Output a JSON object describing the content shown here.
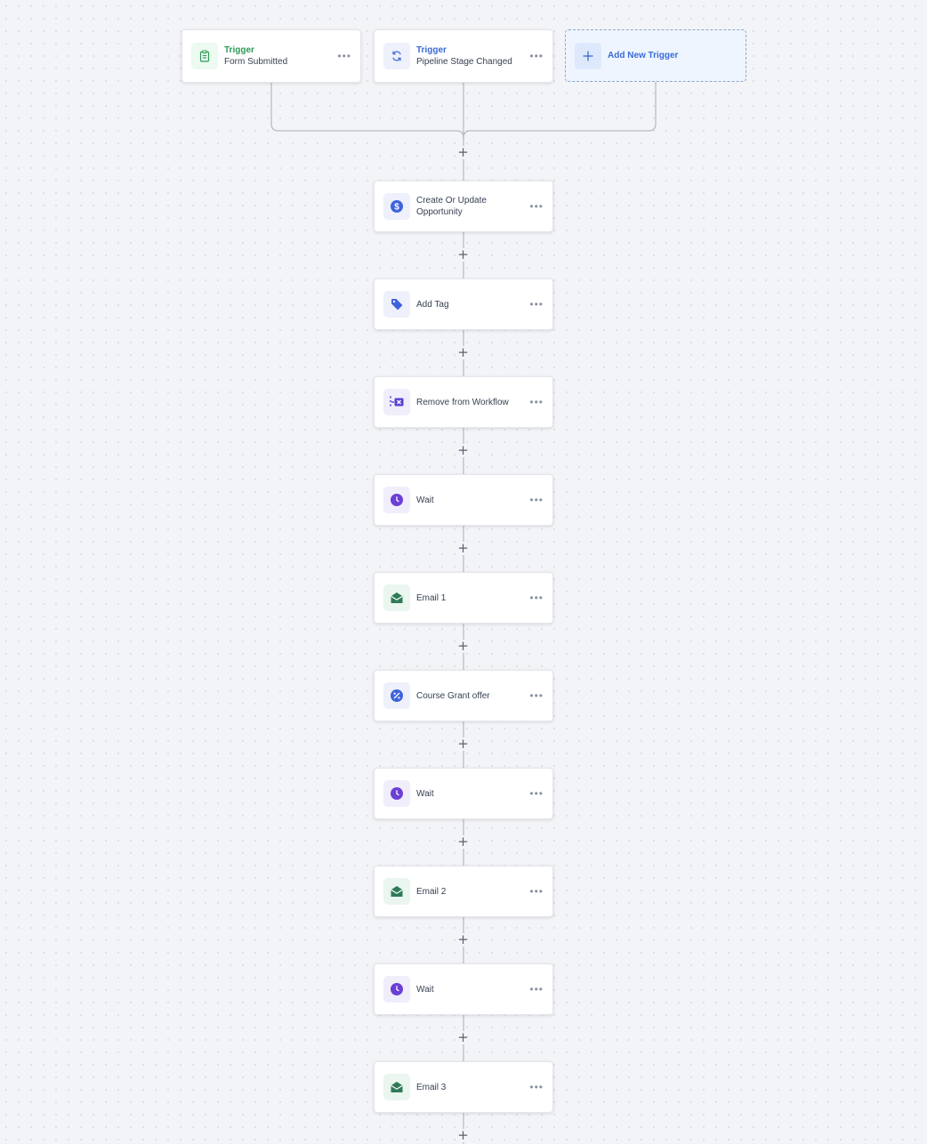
{
  "triggers": [
    {
      "label": "Trigger",
      "name": "Form Submitted",
      "icon": "clipboard-icon",
      "accent": "#2f9a57"
    },
    {
      "label": "Trigger",
      "name": "Pipeline Stage Changed",
      "icon": "refresh-icon",
      "accent": "#3a6ad6"
    }
  ],
  "add_trigger": {
    "label": "Add New Trigger",
    "icon": "plus-icon"
  },
  "steps": [
    {
      "name": "Create Or Update Opportunity",
      "icon": "dollar-icon"
    },
    {
      "name": "Add Tag",
      "icon": "tag-icon"
    },
    {
      "name": "Remove from Workflow",
      "icon": "remove-from-workflow-icon"
    },
    {
      "name": "Wait",
      "icon": "clock-icon"
    },
    {
      "name": "Email 1",
      "icon": "envelope-open-icon"
    },
    {
      "name": "Course Grant offer",
      "icon": "percent-icon"
    },
    {
      "name": "Wait",
      "icon": "clock-icon"
    },
    {
      "name": "Email 2",
      "icon": "envelope-open-icon"
    },
    {
      "name": "Wait",
      "icon": "clock-icon"
    },
    {
      "name": "Email 3",
      "icon": "envelope-open-icon"
    }
  ],
  "menu_glyph": "•••",
  "add_step_glyph": "+",
  "colors": {
    "trigger_green": "#2f9a57",
    "trigger_blue": "#3a6ad6",
    "wait_purple": "#6b3fd4",
    "email_green": "#2f7a58",
    "action_blue": "#3e63dd",
    "background": "#f3f4f7"
  }
}
